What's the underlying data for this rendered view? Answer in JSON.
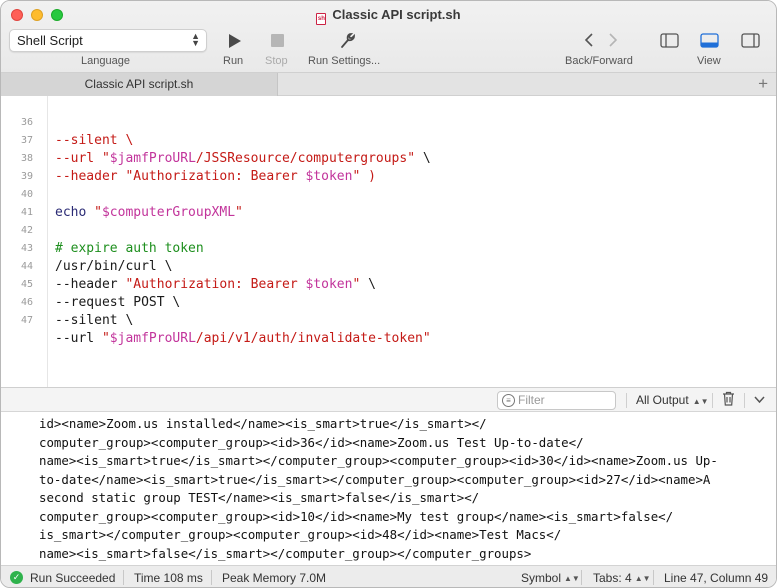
{
  "window": {
    "title": "Classic API script.sh"
  },
  "toolbar": {
    "language_value": "Shell Script",
    "language_label": "Language",
    "run_label": "Run",
    "stop_label": "Stop",
    "settings_label": "Run Settings...",
    "backforward_label": "Back/Forward",
    "view_label": "View"
  },
  "tabs": [
    {
      "label": "Classic API script.sh"
    }
  ],
  "editor": {
    "lines": [
      {
        "num": "36"
      },
      {
        "num": "37"
      },
      {
        "num": "38"
      },
      {
        "num": "39"
      },
      {
        "num": "40"
      },
      {
        "num": "41"
      },
      {
        "num": "42"
      },
      {
        "num": "43"
      },
      {
        "num": "44"
      },
      {
        "num": "45"
      },
      {
        "num": "46"
      },
      {
        "num": "47"
      }
    ],
    "code": {
      "l36": "--silent \\",
      "l37a": "--url ",
      "l37b": "\"",
      "l37c": "$jamfProURL",
      "l37d": "/JSSResource/computergroups\"",
      "l37e": " \\",
      "l38a": "--header ",
      "l38b": "\"Authorization: Bearer ",
      "l38c": "$token",
      "l38d": "\"",
      "l38e": " )",
      "l40a": "echo ",
      "l40b": "\"",
      "l40c": "$computerGroupXML",
      "l40d": "\"",
      "l42": "# expire auth token",
      "l43": "/usr/bin/curl \\",
      "l44a": "--header ",
      "l44b": "\"Authorization: Bearer ",
      "l44c": "$token",
      "l44d": "\"",
      "l44e": " \\",
      "l45": "--request POST \\",
      "l46": "--silent \\",
      "l47a": "--url ",
      "l47b": "\"",
      "l47c": "$jamfProURL",
      "l47d": "/api/v1/auth/invalidate-token\""
    }
  },
  "console": {
    "filter_placeholder": "Filter",
    "output_select": "All Output",
    "lines": [
      "id><name>Zoom.us installed</name><is_smart>true</is_smart></",
      "computer_group><computer_group><id>36</id><name>Zoom.us Test Up-to-date</",
      "name><is_smart>true</is_smart></computer_group><computer_group><id>30</id><name>Zoom.us Up-",
      "to-date</name><is_smart>true</is_smart></computer_group><computer_group><id>27</id><name>A",
      "second static group TEST</name><is_smart>false</is_smart></",
      "computer_group><computer_group><id>10</id><name>My test group</name><is_smart>false</",
      "is_smart></computer_group><computer_group><id>48</id><name>Test Macs</",
      "name><is_smart>false</is_smart></computer_group></computer_groups>"
    ]
  },
  "status": {
    "result": "Run Succeeded",
    "time": "Time 108 ms",
    "memory": "Peak Memory 7.0M",
    "mode": "Symbol",
    "tabs": "Tabs: 4",
    "position": "Line 47, Column 49"
  }
}
